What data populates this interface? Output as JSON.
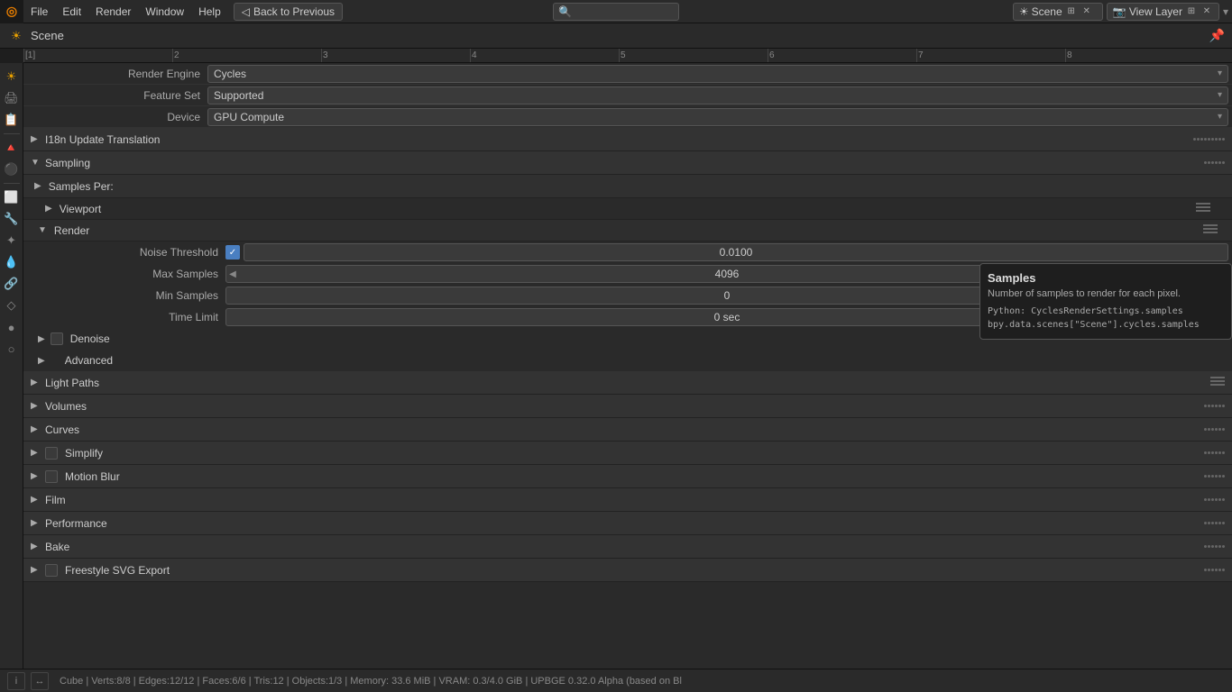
{
  "topMenu": {
    "logo": "◎",
    "items": [
      "File",
      "Edit",
      "Render",
      "Window",
      "Help"
    ],
    "backButton": "Back to Previous",
    "searchPlaceholder": "",
    "scene": {
      "label": "Scene",
      "icon": "🎬"
    },
    "viewLayer": {
      "label": "View Layer",
      "icon": "📷"
    }
  },
  "toolbar": {
    "sceneIcon": "☀",
    "sceneLabel": "Scene"
  },
  "ruler": {
    "marks": [
      {
        "pos": 0,
        "label": "[1]"
      },
      {
        "pos": 165,
        "label": "2"
      },
      {
        "pos": 330,
        "label": "3"
      },
      {
        "pos": 495,
        "label": "4"
      },
      {
        "pos": 660,
        "label": "5"
      },
      {
        "pos": 825,
        "label": "6"
      },
      {
        "pos": 990,
        "label": "7"
      },
      {
        "pos": 1155,
        "label": "8"
      }
    ]
  },
  "sidebar": {
    "icons": [
      {
        "name": "blender-icon",
        "symbol": "◎",
        "active": true
      },
      {
        "name": "output-icon",
        "symbol": "🖼",
        "active": false
      },
      {
        "name": "view-layer-icon",
        "symbol": "📄",
        "active": false
      },
      {
        "name": "scene-icon",
        "symbol": "🔺",
        "active": false
      },
      {
        "name": "world-icon",
        "symbol": "🌐",
        "active": false
      },
      {
        "name": "object-icon",
        "symbol": "⬜",
        "active": false
      },
      {
        "name": "modifier-icon",
        "symbol": "🔧",
        "active": false
      },
      {
        "name": "particles-icon",
        "symbol": "✦",
        "active": false
      },
      {
        "name": "physics-icon",
        "symbol": "🔵",
        "active": false
      },
      {
        "name": "constraints-icon",
        "symbol": "🔗",
        "active": false
      },
      {
        "name": "data-icon",
        "symbol": "🔷",
        "active": false
      }
    ]
  },
  "properties": {
    "renderEngine": {
      "label": "Render Engine",
      "value": "Cycles"
    },
    "featureSet": {
      "label": "Feature Set",
      "value": "Supported"
    },
    "device": {
      "label": "Device",
      "value": "GPU Compute"
    }
  },
  "sections": {
    "i18n": {
      "label": "I18n Update Translation",
      "collapsed": true
    },
    "sampling": {
      "label": "Sampling",
      "expanded": true,
      "samplesPer": "Samples Per:",
      "viewport": {
        "label": "Viewport",
        "collapsed": true
      },
      "render": {
        "label": "Render",
        "expanded": true,
        "noiseThreshold": {
          "label": "Noise Threshold",
          "checked": true,
          "value": "0.0100"
        },
        "maxSamples": {
          "label": "Max Samples",
          "value": "4096"
        },
        "minSamples": {
          "label": "Min Samples",
          "value": "0"
        },
        "timeLimit": {
          "label": "Time Limit",
          "value": "0 sec"
        }
      },
      "denoise": {
        "label": "Denoise",
        "collapsed": true
      },
      "advanced": {
        "label": "Advanced",
        "collapsed": true
      }
    },
    "lightPaths": {
      "label": "Light Paths",
      "collapsed": true
    },
    "volumes": {
      "label": "Volumes",
      "collapsed": true
    },
    "curves": {
      "label": "Curves",
      "collapsed": true
    },
    "simplify": {
      "label": "Simplify",
      "collapsed": true
    },
    "motionBlur": {
      "label": "Motion Blur",
      "collapsed": true
    },
    "film": {
      "label": "Film",
      "collapsed": true
    },
    "performance": {
      "label": "Performance",
      "collapsed": true
    },
    "bake": {
      "label": "Bake",
      "collapsed": true
    },
    "freestyleSVG": {
      "label": "Freestyle SVG Export",
      "collapsed": true
    }
  },
  "tooltip": {
    "title": "Samples",
    "description": "Number of samples to render for each pixel.",
    "python1": "Python: CyclesRenderSettings.samples",
    "python2": "bpy.data.scenes[\"Scene\"].cycles.samples"
  },
  "statusBar": {
    "text": "Cube | Verts:8/8 | Edges:12/12 | Faces:6/6 | Tris:12 | Objects:1/3 | Memory: 33.6 MiB | VRAM: 0.3/4.0 GiB | UPBGE 0.32.0 Alpha (based on Bl"
  }
}
